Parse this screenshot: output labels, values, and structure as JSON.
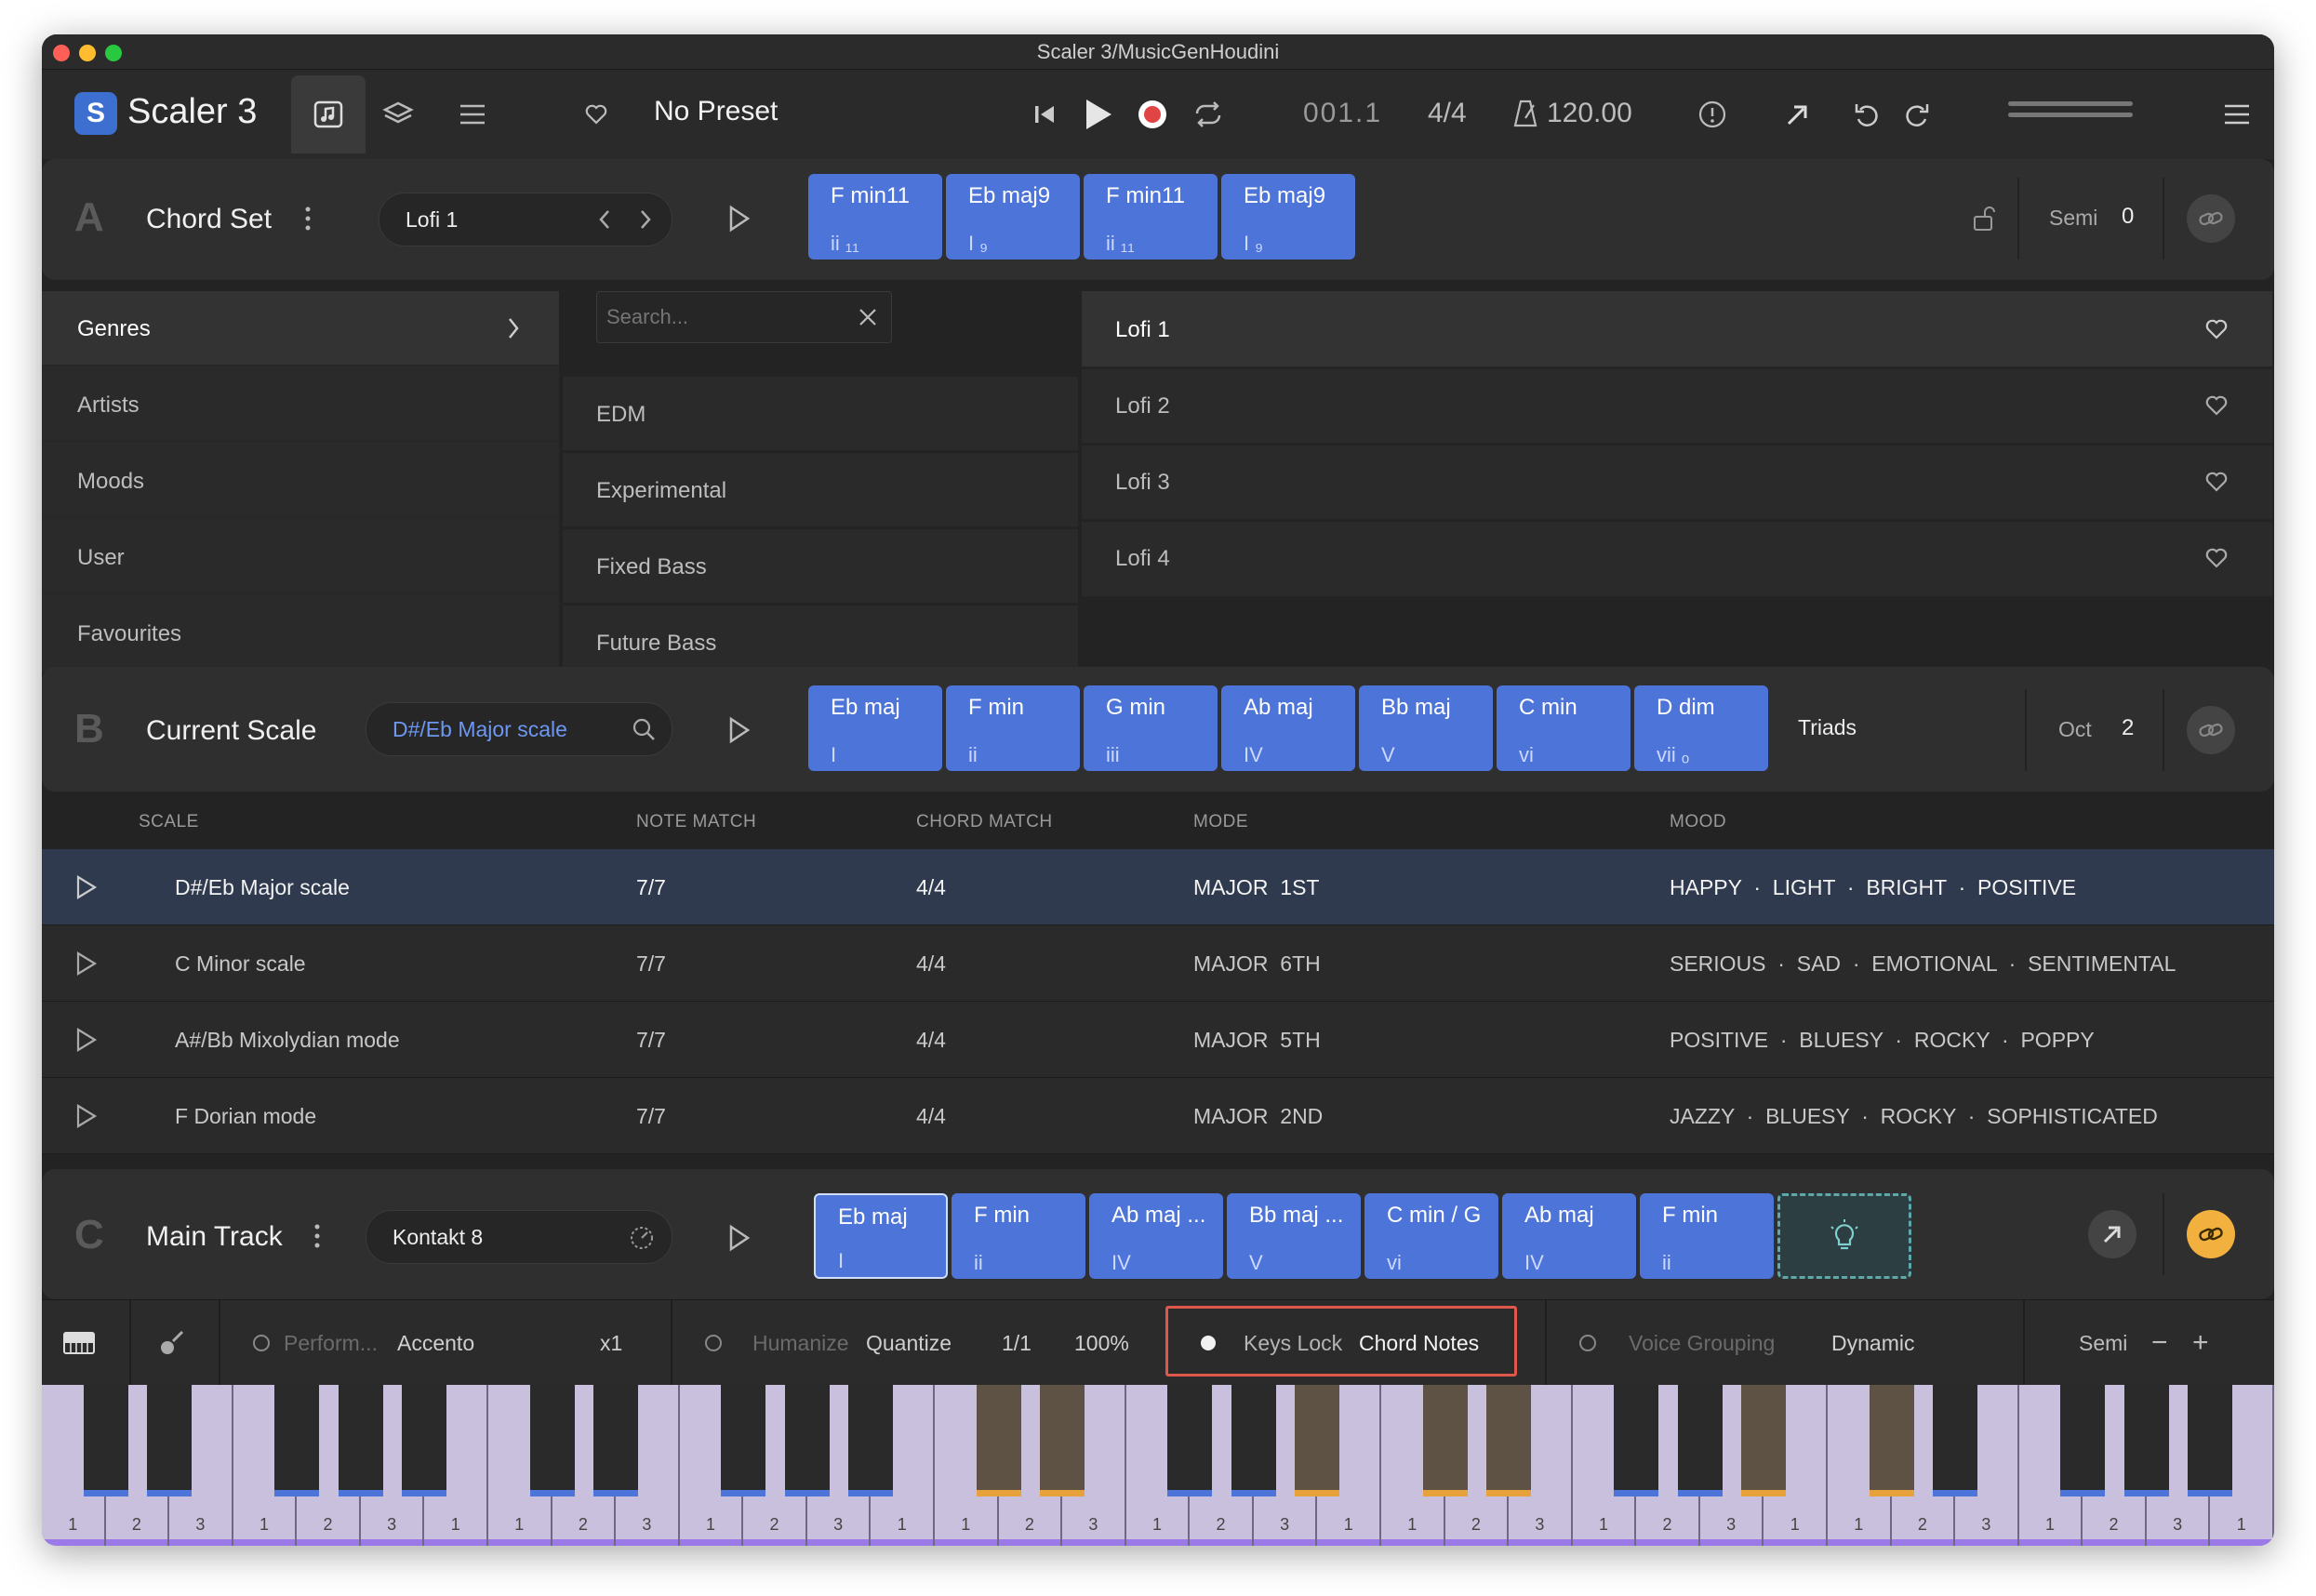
{
  "window": {
    "title": "Scaler 3/MusicGenHoudini"
  },
  "toolbar": {
    "app_name": "Scaler 3",
    "preset_name": "No Preset",
    "position": "001.1",
    "time_signature": "4/4",
    "tempo": "120.00"
  },
  "section_a": {
    "letter": "A",
    "title": "Chord Set",
    "preset": "Lofi 1",
    "chords": [
      {
        "name": "F min11",
        "degree": "ii ₁₁"
      },
      {
        "name": "Eb maj9",
        "degree": "I ₉"
      },
      {
        "name": "F min11",
        "degree": "ii ₁₁"
      },
      {
        "name": "Eb maj9",
        "degree": "I ₉"
      }
    ],
    "semi_label": "Semi",
    "semi_value": "0"
  },
  "browser": {
    "categories": [
      "Genres",
      "Artists",
      "Moods",
      "User",
      "Favourites"
    ],
    "search_placeholder": "Search...",
    "genres": [
      "EDM",
      "Experimental",
      "Fixed Bass",
      "Future Bass"
    ],
    "presets": [
      "Lofi 1",
      "Lofi 2",
      "Lofi 3",
      "Lofi 4"
    ]
  },
  "section_b": {
    "letter": "B",
    "title": "Current Scale",
    "scale": "D#/Eb Major scale",
    "chords": [
      {
        "name": "Eb maj",
        "degree": "I"
      },
      {
        "name": "F min",
        "degree": "ii"
      },
      {
        "name": "G min",
        "degree": "iii"
      },
      {
        "name": "Ab maj",
        "degree": "IV"
      },
      {
        "name": "Bb maj",
        "degree": "V"
      },
      {
        "name": "C min",
        "degree": "vi"
      },
      {
        "name": "D dim",
        "degree": "vii ₒ"
      }
    ],
    "mode_label": "Triads",
    "oct_label": "Oct",
    "oct_value": "2"
  },
  "scale_table": {
    "headers": [
      "SCALE",
      "NOTE MATCH",
      "CHORD MATCH",
      "MODE",
      "MOOD"
    ],
    "rows": [
      {
        "scale": "D#/Eb Major scale",
        "note": "7/7",
        "chord": "4/4",
        "mode": "MAJOR  1ST",
        "mood": "HAPPY  ·  LIGHT  ·  BRIGHT  ·  POSITIVE"
      },
      {
        "scale": "C Minor scale",
        "note": "7/7",
        "chord": "4/4",
        "mode": "MAJOR  6TH",
        "mood": "SERIOUS  ·  SAD  ·  EMOTIONAL  ·  SENTIMENTAL"
      },
      {
        "scale": "A#/Bb Mixolydian mode",
        "note": "7/7",
        "chord": "4/4",
        "mode": "MAJOR  5TH",
        "mood": "POSITIVE  ·  BLUESY  ·  ROCKY  ·  POPPY"
      },
      {
        "scale": "F Dorian mode",
        "note": "7/7",
        "chord": "4/4",
        "mode": "MAJOR  2ND",
        "mood": "JAZZY  ·  BLUESY  ·  ROCKY  ·  SOPHISTICATED"
      }
    ]
  },
  "section_c": {
    "letter": "C",
    "title": "Main Track",
    "instrument": "Kontakt 8",
    "chords": [
      {
        "name": "Eb maj",
        "degree": "I"
      },
      {
        "name": "F min",
        "degree": "ii"
      },
      {
        "name": "Ab maj ...",
        "degree": "IV"
      },
      {
        "name": "Bb maj ...",
        "degree": "V"
      },
      {
        "name": "C min / G",
        "degree": "vi"
      },
      {
        "name": "Ab maj",
        "degree": "IV"
      },
      {
        "name": "F min",
        "degree": "ii"
      }
    ]
  },
  "bottom_bar": {
    "perform_label": "Perform...",
    "perform_value": "Accento",
    "perform_mult": "x1",
    "humanize_label": "Humanize",
    "quantize_label": "Quantize",
    "quantize_value": "1/1",
    "quantize_pct": "100%",
    "keys_lock_label": "Keys Lock",
    "keys_lock_value": "Chord Notes",
    "voice_grouping_label": "Voice Grouping",
    "voice_grouping_value": "Dynamic",
    "semi_label": "Semi",
    "minus": "−",
    "plus": "+"
  },
  "colors": {
    "chord_blue": "#4d74d8",
    "accent_orange": "#f2b13e",
    "record_red": "#e04444",
    "keys_lock_outline": "#e0584b",
    "marker_blue": "#4d74d8",
    "marker_orange": "#e8a23c"
  },
  "piano": {
    "finger_numbers": [
      "1",
      "2",
      "3",
      "1",
      "2",
      "3",
      "1",
      "1",
      "2",
      "3",
      "1",
      "2",
      "3",
      "1",
      "1",
      "2",
      "3",
      "1",
      "2",
      "3",
      "1",
      "1",
      "2",
      "3",
      "1",
      "2",
      "3",
      "1",
      "1",
      "2",
      "3",
      "1",
      "2",
      "3",
      "1"
    ]
  }
}
